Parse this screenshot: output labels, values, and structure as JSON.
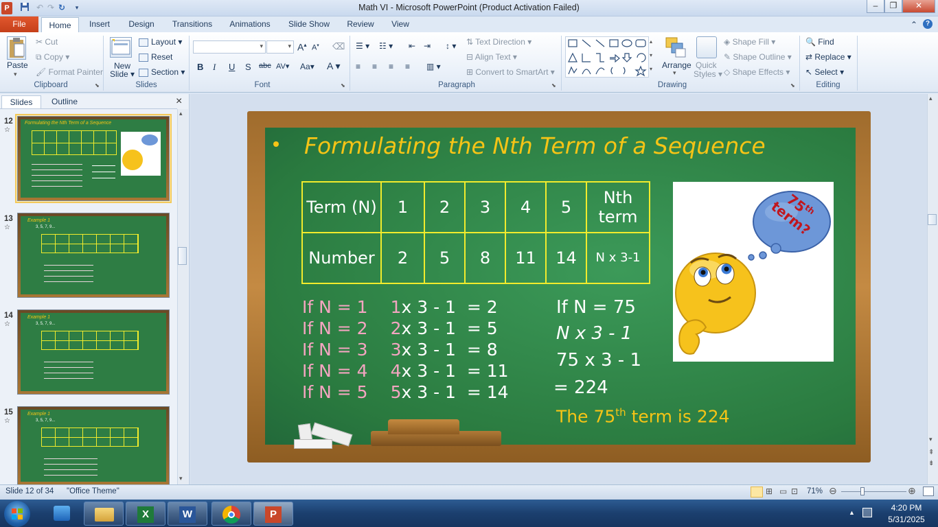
{
  "window": {
    "title": "Math VI - Microsoft PowerPoint (Product Activation Failed)",
    "app_icon": "P"
  },
  "tabs": [
    "File",
    "Home",
    "Insert",
    "Design",
    "Transitions",
    "Animations",
    "Slide Show",
    "Review",
    "View"
  ],
  "ribbon": {
    "clipboard": {
      "label": "Clipboard",
      "paste": "Paste",
      "cut": "Cut",
      "copy": "Copy",
      "format_painter": "Format Painter"
    },
    "slides": {
      "label": "Slides",
      "new_slide_1": "New",
      "new_slide_2": "Slide",
      "layout": "Layout",
      "reset": "Reset",
      "section": "Section"
    },
    "font": {
      "label": "Font",
      "bold": "B",
      "italic": "I",
      "underline": "U",
      "shadow": "S",
      "strike": "abc",
      "spacing": "AV",
      "case": "Aa",
      "color": "A",
      "grow": "A",
      "shrink": "A"
    },
    "paragraph": {
      "label": "Paragraph",
      "text_direction": "Text Direction",
      "align_text": "Align Text",
      "convert_smartart": "Convert to SmartArt"
    },
    "drawing": {
      "label": "Drawing",
      "arrange": "Arrange",
      "quick_styles_1": "Quick",
      "quick_styles_2": "Styles",
      "shape_fill": "Shape Fill",
      "shape_outline": "Shape Outline",
      "shape_effects": "Shape Effects"
    },
    "editing": {
      "label": "Editing",
      "find": "Find",
      "replace": "Replace",
      "select": "Select"
    }
  },
  "pane": {
    "tab_slides": "Slides",
    "tab_outline": "Outline",
    "close": "×"
  },
  "thumbnails": [
    {
      "num": "12",
      "star": "☆",
      "title": "Formulating the Nth Term of a Sequence",
      "selected": true
    },
    {
      "num": "13",
      "star": "☆",
      "title": "Example 1",
      "seq": "3, 5, 7, 9...",
      "selected": false
    },
    {
      "num": "14",
      "star": "☆",
      "title": "Example 1",
      "seq": "3, 5, 7, 9...",
      "selected": false
    },
    {
      "num": "15",
      "star": "☆",
      "title": "Example 1",
      "seq": "3, 5, 7, 9...",
      "selected": false
    }
  ],
  "slide": {
    "title": "Formulating the Nth Term of a Sequence",
    "table": {
      "row1": [
        "Term (N)",
        "1",
        "2",
        "3",
        "4",
        "5",
        "Nth term"
      ],
      "row2": [
        "Number",
        "2",
        "5",
        "8",
        "11",
        "14",
        "N x 3-1"
      ]
    },
    "cases": [
      {
        "cond": "If N = 1",
        "n": "1",
        "rest": "x 3 - 1  = 2"
      },
      {
        "cond": "If N = 2",
        "n": "2",
        "rest": "x 3 - 1  = 5"
      },
      {
        "cond": "If N = 3",
        "n": "3",
        "rest": "x 3 - 1  = 8"
      },
      {
        "cond": "If N = 4",
        "n": "4",
        "rest": "x 3 - 1  = 11"
      },
      {
        "cond": "If N = 5",
        "n": "5",
        "rest": "x 3 - 1  = 14"
      }
    ],
    "solution": [
      "If N = 75",
      "N x 3 - 1",
      "75 x 3 - 1",
      "= 224"
    ],
    "answer_pre": "The 75",
    "answer_sup": "th",
    "answer_post": " term is 224",
    "bubble_1": "75",
    "bubble_sup": "th",
    "bubble_2": "term?"
  },
  "status": {
    "slide_info": "Slide 12 of 34",
    "theme": "\"Office Theme\"",
    "zoom": "71%"
  },
  "clock": {
    "time": "4:20 PM",
    "date": "5/31/2025"
  },
  "colors": {
    "chalkboard": "#2e7d44",
    "title_yellow": "#f5c416",
    "table_border": "#f2ec2c",
    "pink": "#f4a5c1",
    "file_tab": "#d14d24"
  }
}
